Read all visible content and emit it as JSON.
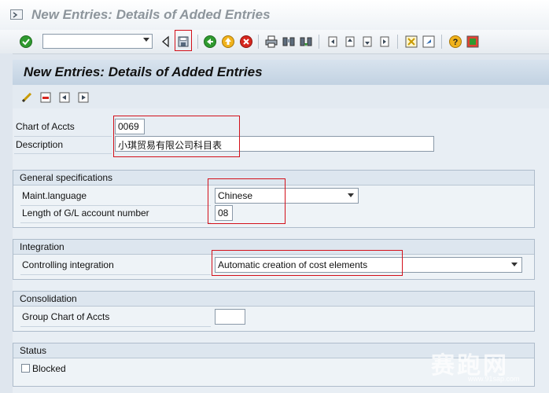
{
  "window": {
    "title": "New Entries: Details of Added Entries"
  },
  "toolbar": {
    "command_field": {
      "value": "",
      "placeholder": ""
    },
    "icons": [
      "enter-check-icon",
      "back-triangle-icon",
      "save-icon",
      "back-icon",
      "exit-icon",
      "cancel-icon",
      "print-icon",
      "find-icon",
      "find-next-icon",
      "first-page-icon",
      "previous-page-icon",
      "next-page-icon",
      "last-page-icon",
      "create-session-icon",
      "shortcut-icon",
      "help-icon",
      "layout-icon"
    ]
  },
  "screen": {
    "title": "New Entries: Details of Added Entries"
  },
  "app_toolbar": {
    "icons": [
      "edit-pencil-icon",
      "delete-icon",
      "previous-entry-icon",
      "next-entry-icon"
    ]
  },
  "form": {
    "chart_of_accts": {
      "label": "Chart of Accts",
      "value": "0069"
    },
    "description": {
      "label": "Description",
      "value": "小琪贸易有限公司科目表"
    }
  },
  "groups": {
    "general": {
      "title": "General specifications",
      "maint_language": {
        "label": "Maint.language",
        "value": "Chinese"
      },
      "gl_length": {
        "label": "Length of G/L account number",
        "value": "08"
      }
    },
    "integration": {
      "title": "Integration",
      "controlling": {
        "label": "Controlling integration",
        "value": "Automatic creation of cost elements"
      }
    },
    "consolidation": {
      "title": "Consolidation",
      "group_chart": {
        "label": "Group Chart of Accts",
        "value": ""
      }
    },
    "status": {
      "title": "Status",
      "blocked": {
        "label": "Blocked",
        "checked": false
      }
    }
  },
  "watermark": {
    "text": "赛跑网",
    "url": "www.91sap.com"
  },
  "colors": {
    "highlight": "#d3101a",
    "header_bg": "#c9d8e7",
    "content_bg": "#e8eef4"
  }
}
